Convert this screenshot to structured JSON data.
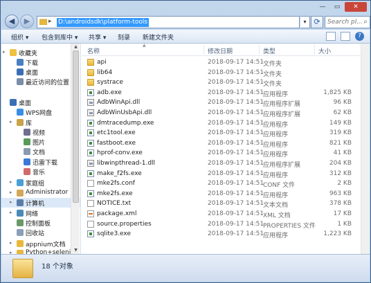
{
  "address": {
    "path": "D:\\androidsdk\\platform-tools",
    "search_placeholder": "Search pl..."
  },
  "window_controls": {
    "minimize": "—",
    "maximize": "▭",
    "close": "✕"
  },
  "toolbar": {
    "organize": "组织 ▾",
    "include_in_library": "包含到库中 ▾",
    "share": "共享 ▾",
    "burn": "刻录",
    "new_folder": "新建文件夹"
  },
  "columns": {
    "name": "名称",
    "date": "修改日期",
    "type": "类型",
    "size": "大小"
  },
  "sidebar": {
    "items": [
      {
        "label": "收藏夹",
        "icon": "star-icon"
      },
      {
        "label": "下载",
        "icon": "download-icon"
      },
      {
        "label": "桌面",
        "icon": "desktop-icon"
      },
      {
        "label": "最近访问的位置",
        "icon": "recent-icon"
      },
      {
        "label": "桌面",
        "icon": "desktop-icon"
      },
      {
        "label": "WPS网盘",
        "icon": "cloud-icon"
      },
      {
        "label": "库",
        "icon": "library-icon"
      },
      {
        "label": "视频",
        "icon": "video-icon"
      },
      {
        "label": "图片",
        "icon": "picture-icon"
      },
      {
        "label": "文档",
        "icon": "document-icon"
      },
      {
        "label": "迅雷下载",
        "icon": "thunder-icon"
      },
      {
        "label": "音乐",
        "icon": "music-icon"
      },
      {
        "label": "家庭组",
        "icon": "homegroup-icon"
      },
      {
        "label": "Administrator",
        "icon": "user-icon"
      },
      {
        "label": "计算机",
        "icon": "computer-icon"
      },
      {
        "label": "网络",
        "icon": "network-icon"
      },
      {
        "label": "控制面板",
        "icon": "control-panel-icon"
      },
      {
        "label": "回收站",
        "icon": "recycle-bin-icon"
      },
      {
        "label": "appnium文档",
        "icon": "folder-icon"
      },
      {
        "label": "Python+seleniu",
        "icon": "folder-icon"
      }
    ]
  },
  "files": [
    {
      "name": "api",
      "date": "2018-09-17 14:51",
      "type": "文件夹",
      "size": "",
      "icon": "folder"
    },
    {
      "name": "lib64",
      "date": "2018-09-17 14:51",
      "type": "文件夹",
      "size": "",
      "icon": "folder"
    },
    {
      "name": "systrace",
      "date": "2018-09-17 14:51",
      "type": "文件夹",
      "size": "",
      "icon": "folder"
    },
    {
      "name": "adb.exe",
      "date": "2018-09-17 14:51",
      "type": "应用程序",
      "size": "1,825 KB",
      "icon": "exe"
    },
    {
      "name": "AdbWinApi.dll",
      "date": "2018-09-17 14:51",
      "type": "应用程序扩展",
      "size": "96 KB",
      "icon": "dll"
    },
    {
      "name": "AdbWinUsbApi.dll",
      "date": "2018-09-17 14:51",
      "type": "应用程序扩展",
      "size": "62 KB",
      "icon": "dll"
    },
    {
      "name": "dmtracedump.exe",
      "date": "2018-09-17 14:51",
      "type": "应用程序",
      "size": "149 KB",
      "icon": "exe"
    },
    {
      "name": "etc1tool.exe",
      "date": "2018-09-17 14:51",
      "type": "应用程序",
      "size": "319 KB",
      "icon": "exe"
    },
    {
      "name": "fastboot.exe",
      "date": "2018-09-17 14:51",
      "type": "应用程序",
      "size": "821 KB",
      "icon": "exe"
    },
    {
      "name": "hprof-conv.exe",
      "date": "2018-09-17 14:51",
      "type": "应用程序",
      "size": "41 KB",
      "icon": "exe"
    },
    {
      "name": "libwinpthread-1.dll",
      "date": "2018-09-17 14:51",
      "type": "应用程序扩展",
      "size": "204 KB",
      "icon": "dll"
    },
    {
      "name": "make_f2fs.exe",
      "date": "2018-09-17 14:51",
      "type": "应用程序",
      "size": "312 KB",
      "icon": "exe"
    },
    {
      "name": "mke2fs.conf",
      "date": "2018-09-17 14:51",
      "type": "CONF 文件",
      "size": "2 KB",
      "icon": "doc"
    },
    {
      "name": "mke2fs.exe",
      "date": "2018-09-17 14:51",
      "type": "应用程序",
      "size": "963 KB",
      "icon": "exe"
    },
    {
      "name": "NOTICE.txt",
      "date": "2018-09-17 14:51",
      "type": "文本文档",
      "size": "378 KB",
      "icon": "doc"
    },
    {
      "name": "package.xml",
      "date": "2018-09-17 14:51",
      "type": "XML 文档",
      "size": "17 KB",
      "icon": "xml"
    },
    {
      "name": "source.properties",
      "date": "2018-09-17 14:51",
      "type": "PROPERTIES 文件",
      "size": "1 KB",
      "icon": "doc"
    },
    {
      "name": "sqlite3.exe",
      "date": "2018-09-17 14:51",
      "type": "应用程序",
      "size": "1,223 KB",
      "icon": "exe"
    }
  ],
  "status": {
    "count": "18 个对象"
  }
}
